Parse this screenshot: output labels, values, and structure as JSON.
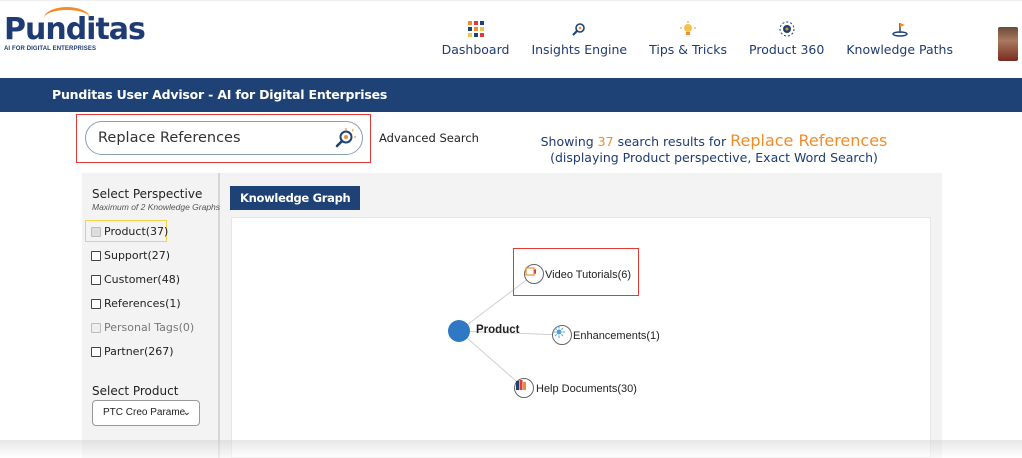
{
  "brand": {
    "name": "Punditas",
    "tagline": "AI FOR DIGITAL ENTERPRISES",
    "primary_color": "#1f3b73",
    "accent_color": "#f28c28"
  },
  "nav": {
    "items": [
      {
        "label": "Dashboard",
        "icon": "dashboard-grid-icon"
      },
      {
        "label": "Insights Engine",
        "icon": "insights-icon"
      },
      {
        "label": "Tips & Tricks",
        "icon": "lightbulb-icon"
      },
      {
        "label": "Product 360",
        "icon": "product360-icon"
      },
      {
        "label": "Knowledge Paths",
        "icon": "knowledge-path-icon"
      }
    ]
  },
  "banner": {
    "title": "Punditas User Advisor - AI for Digital Enterprises",
    "color": "#1e4275"
  },
  "search": {
    "value": "Replace References",
    "advanced_label": "Advanced Search"
  },
  "results": {
    "prefix": "Showing",
    "count": "37",
    "middle": "search results for",
    "query": "Replace References",
    "detail": "(displaying Product perspective, Exact Word Search)"
  },
  "perspective": {
    "title": "Select Perspective",
    "subtitle": "Maximum of 2 Knowledge Graphs",
    "options": [
      {
        "label": "Product(37)",
        "state": "checked-disabled"
      },
      {
        "label": "Support(27)",
        "state": "unchecked"
      },
      {
        "label": "Customer(48)",
        "state": "unchecked"
      },
      {
        "label": "References(1)",
        "state": "unchecked"
      },
      {
        "label": "Personal Tags(0)",
        "state": "disabled"
      },
      {
        "label": "Partner(267)",
        "state": "unchecked"
      }
    ]
  },
  "product_select": {
    "title": "Select Product",
    "value": "PTC Creo Parame"
  },
  "graph": {
    "tab_label": "Knowledge Graph",
    "root": "Product",
    "nodes": [
      {
        "label": "Video Tutorials(6)",
        "icon": "video-tutorial-icon"
      },
      {
        "label": "Enhancements(1)",
        "icon": "enhancement-icon"
      },
      {
        "label": "Help Documents(30)",
        "icon": "help-documents-icon"
      }
    ]
  }
}
